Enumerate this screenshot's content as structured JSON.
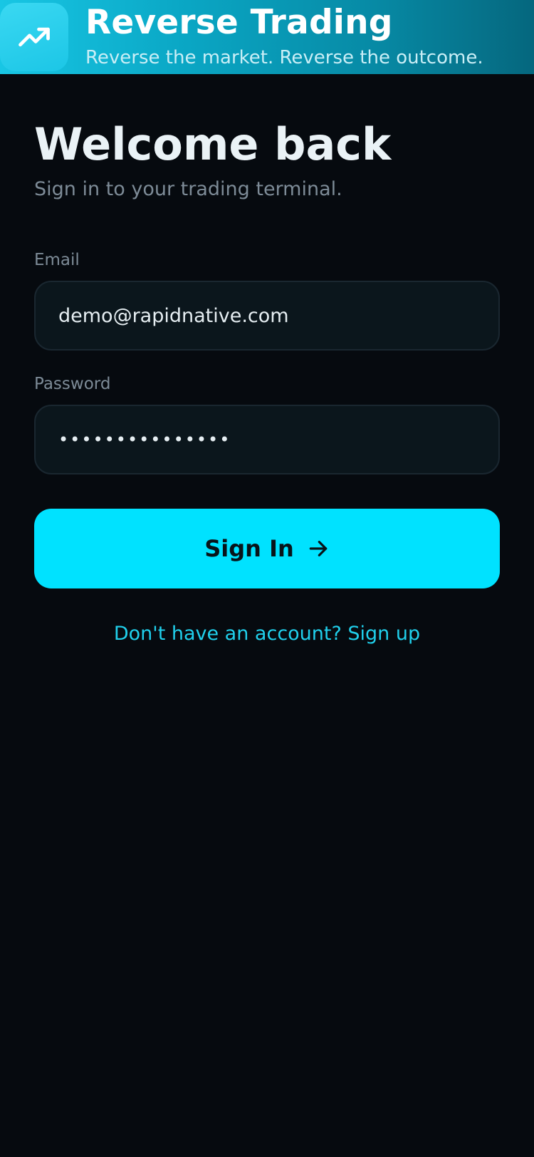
{
  "header": {
    "app_title": "Reverse Trading",
    "tagline": "Reverse the market. Reverse the outcome.",
    "icon": "trending-up-icon"
  },
  "login": {
    "heading": "Welcome back",
    "subtitle": "Sign in to your trading terminal.",
    "email_label": "Email",
    "email_value": "demo@rapidnative.com",
    "password_label": "Password",
    "password_value": "•••••••••••••••",
    "submit_label": "Sign In",
    "submit_icon": "arrow-right-icon",
    "signup_link": "Don't have an account? Sign up"
  },
  "colors": {
    "background": "#060a0f",
    "accent": "#00e2ff",
    "link": "#20d0ec",
    "field_background": "#0b161c"
  }
}
